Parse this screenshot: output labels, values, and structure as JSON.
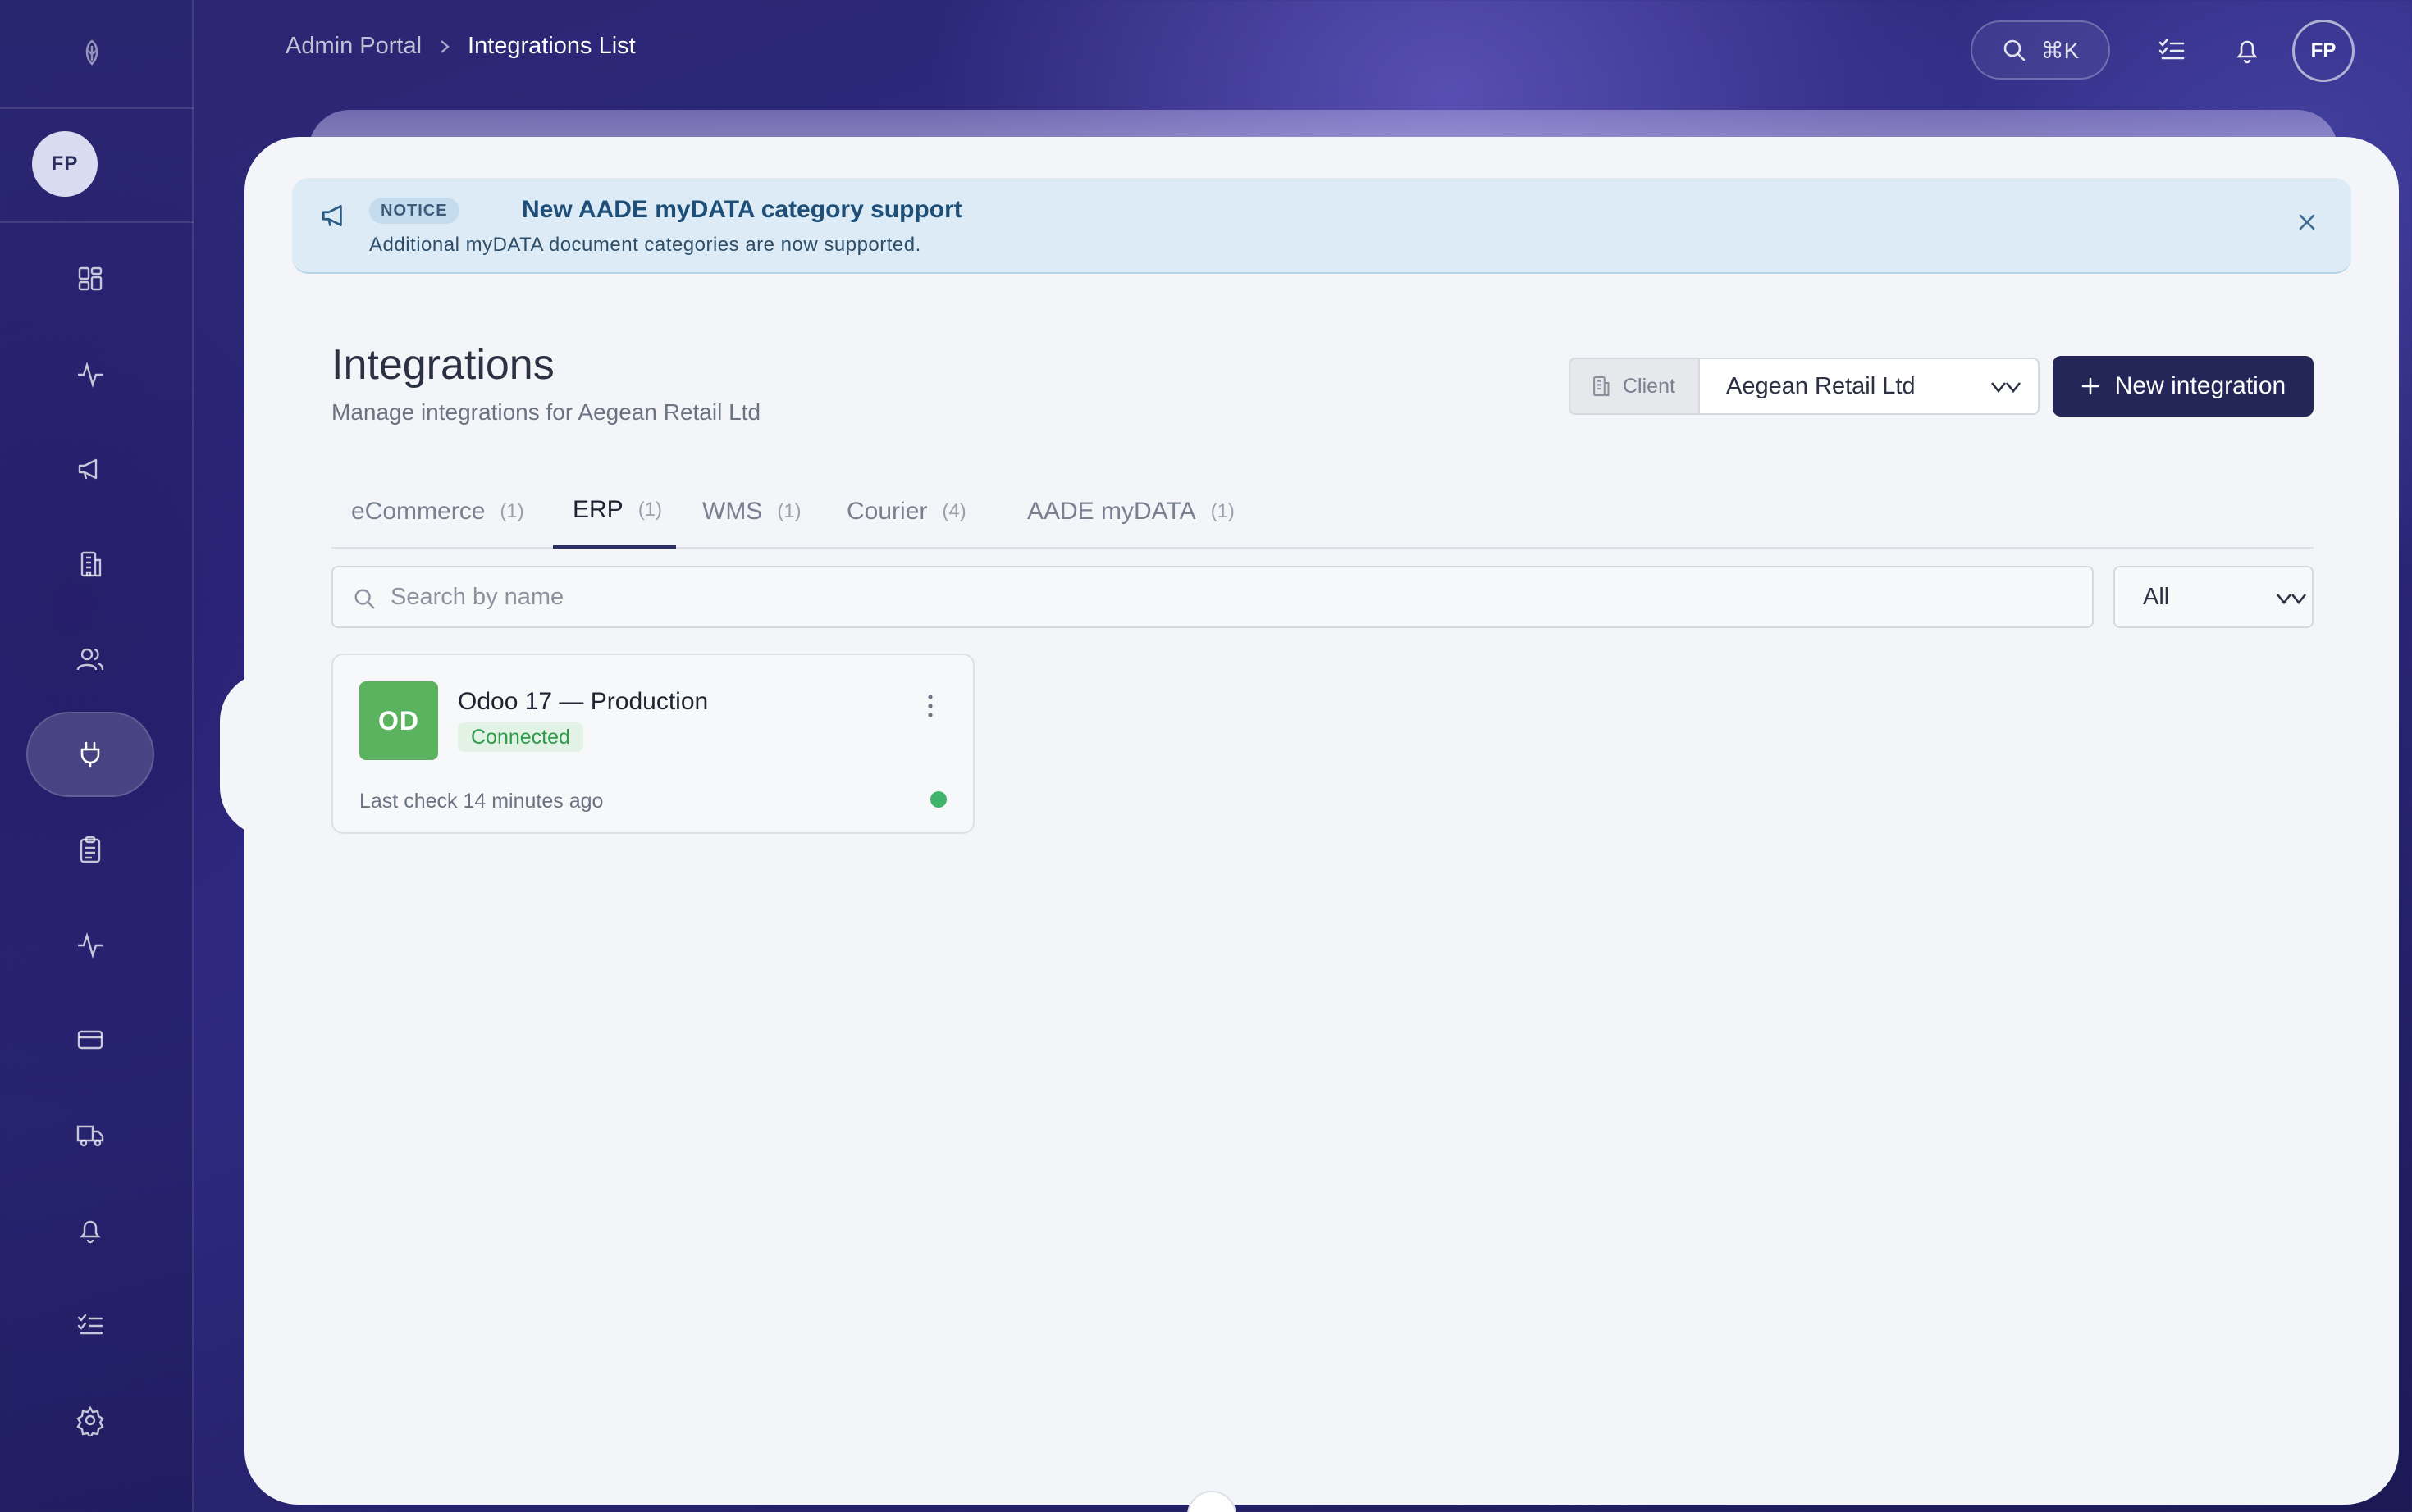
{
  "breadcrumb": {
    "root": "Admin Portal",
    "current": "Integrations List"
  },
  "topbar": {
    "search_shortcut": "⌘K",
    "user_initials": "FP"
  },
  "sidebar": {
    "user_initials": "FP",
    "items": [
      {
        "icon": "dashboard-icon"
      },
      {
        "icon": "activity-icon"
      },
      {
        "icon": "megaphone-icon"
      },
      {
        "icon": "building-icon"
      },
      {
        "icon": "users-icon"
      },
      {
        "icon": "plug-icon",
        "active": true
      },
      {
        "icon": "clipboard-icon"
      },
      {
        "icon": "pulse-icon"
      },
      {
        "icon": "credit-card-icon"
      },
      {
        "icon": "truck-icon"
      },
      {
        "icon": "bell-icon"
      },
      {
        "icon": "checklist-icon"
      },
      {
        "icon": "gear-icon"
      }
    ]
  },
  "notice": {
    "badge": "NOTICE",
    "title": "New AADE myDATA category support",
    "text": "Additional myDATA document categories are now supported."
  },
  "header": {
    "title": "Integrations",
    "subtitle": "Manage integrations for Aegean Retail Ltd",
    "client_label": "Client",
    "client_value": "Aegean Retail Ltd",
    "new_button": "New integration"
  },
  "tabs": [
    {
      "label": "eCommerce",
      "count": "(1)"
    },
    {
      "label": "ERP",
      "count": "(1)",
      "active": true
    },
    {
      "label": "WMS",
      "count": "(1)"
    },
    {
      "label": "Courier",
      "count": "(4)"
    },
    {
      "label": "AADE myDATA",
      "count": "(1)"
    }
  ],
  "search": {
    "placeholder": "Search by name",
    "filter_value": "All"
  },
  "integrations": [
    {
      "initials": "OD",
      "name": "Odoo 17 — Production",
      "status": "Connected",
      "last_check": "Last check 14 minutes ago",
      "status_color": "#3fb36a"
    }
  ],
  "colors": {
    "accent": "#242657",
    "connected": "#2e9a4c",
    "notice_bg": "#dcebf5"
  }
}
